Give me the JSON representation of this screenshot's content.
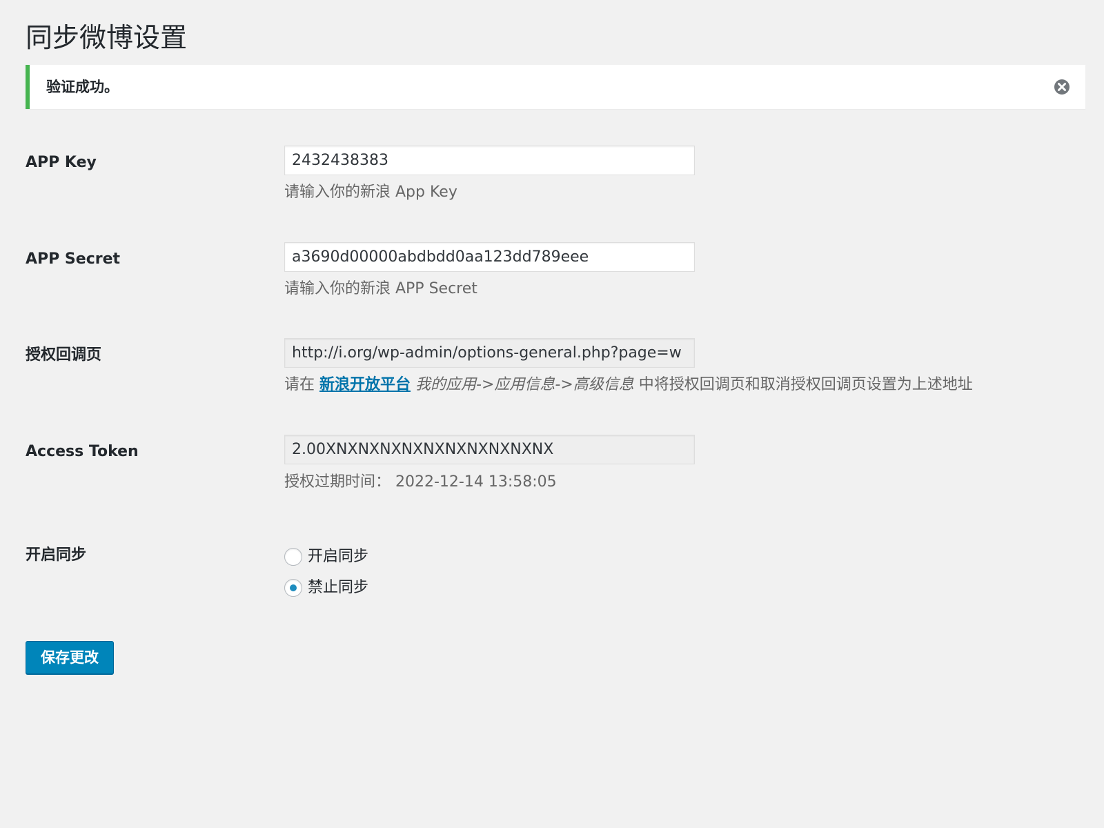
{
  "page": {
    "title": "同步微博设置"
  },
  "notice": {
    "message": "验证成功。",
    "dismiss_icon": "close-circle-icon",
    "accent_color": "#46b450"
  },
  "fields": {
    "app_key": {
      "label": "APP Key",
      "value": "2432438383",
      "description": "请输入你的新浪 App Key"
    },
    "app_secret": {
      "label": "APP Secret",
      "value": "a3690d00000abdbdd0aa123dd789eee",
      "description": "请输入你的新浪 APP Secret"
    },
    "callback": {
      "label": "授权回调页",
      "value": "http://i.org/wp-admin/options-general.php?page=w",
      "description_prefix": "请在 ",
      "description_link": "新浪开放平台",
      "description_path": "我的应用->应用信息->高级信息",
      "description_suffix": " 中将授权回调页和取消授权回调页设置为上述地址"
    },
    "access_token": {
      "label": "Access Token",
      "value": "2.00XNXNXNXNXNXNXNXNXNXNX",
      "description": "授权过期时间：  2022-12-14 13:58:05"
    },
    "sync": {
      "label": "开启同步",
      "options": [
        {
          "label": "开启同步",
          "checked": false
        },
        {
          "label": "禁止同步",
          "checked": true
        }
      ]
    }
  },
  "actions": {
    "save_label": "保存更改",
    "primary_color": "#0085ba",
    "link_color": "#0073aa",
    "radio_color": "#1e8cbe"
  }
}
